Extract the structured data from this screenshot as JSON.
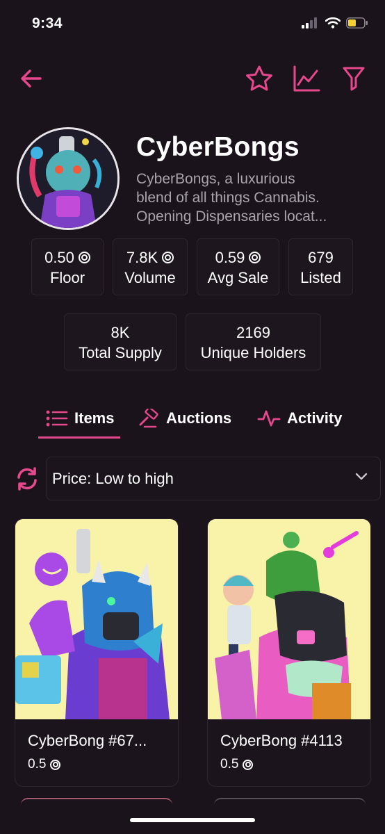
{
  "status_bar": {
    "time": "9:34"
  },
  "collection": {
    "name": "CyberBongs",
    "description_lines": [
      "CyberBongs, a luxurious",
      "blend of all things Cannabis.",
      "Opening Dispensaries locat..."
    ]
  },
  "stats": [
    {
      "value": "0.50",
      "label": "Floor",
      "sol": true
    },
    {
      "value": "7.8K",
      "label": "Volume",
      "sol": true
    },
    {
      "value": "0.59",
      "label": "Avg Sale",
      "sol": true
    },
    {
      "value": "679",
      "label": "Listed",
      "sol": false
    }
  ],
  "supply_stats": [
    {
      "value": "8K",
      "label": "Total Supply"
    },
    {
      "value": "2169",
      "label": "Unique Holders"
    }
  ],
  "tabs": [
    {
      "label": "Items",
      "icon": "list-icon",
      "active": true
    },
    {
      "label": "Auctions",
      "icon": "gavel-icon",
      "active": false
    },
    {
      "label": "Activity",
      "icon": "activity-icon",
      "active": false
    }
  ],
  "sort": {
    "selected": "Price: Low to high"
  },
  "items": [
    {
      "name": "CyberBong #67...",
      "price": "0.5"
    },
    {
      "name": "CyberBong #4113",
      "price": "0.5"
    }
  ],
  "colors": {
    "accent": "#e5488c",
    "background": "#1b131b",
    "card_bg": "#f7f1a6"
  }
}
